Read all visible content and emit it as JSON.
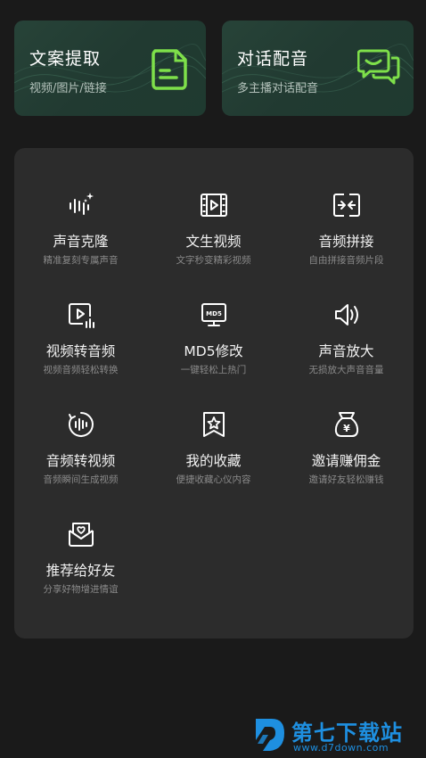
{
  "top_cards": [
    {
      "title": "文案提取",
      "subtitle": "视频/图片/链接",
      "icon": "document-extract-icon"
    },
    {
      "title": "对话配音",
      "subtitle": "多主播对话配音",
      "icon": "chat-dubbing-icon"
    }
  ],
  "features": [
    {
      "name": "声音克隆",
      "desc": "精准复刻专属声音",
      "icon": "voice-clone-icon"
    },
    {
      "name": "文生视频",
      "desc": "文字秒变精彩视频",
      "icon": "film-strip-icon"
    },
    {
      "name": "音频拼接",
      "desc": "自由拼接音频片段",
      "icon": "merge-arrows-icon"
    },
    {
      "name": "视频转音频",
      "desc": "视频音频轻松转换",
      "icon": "video-to-audio-icon"
    },
    {
      "name": "MD5修改",
      "desc": "一键轻松上热门",
      "icon": "md5-monitor-icon",
      "icon_text": "MD5"
    },
    {
      "name": "声音放大",
      "desc": "无损放大声音音量",
      "icon": "speaker-icon"
    },
    {
      "name": "音频转视频",
      "desc": "音频瞬间生成视频",
      "icon": "audio-to-video-icon"
    },
    {
      "name": "我的收藏",
      "desc": "便捷收藏心仪内容",
      "icon": "star-bookmark-icon"
    },
    {
      "name": "邀请赚佣金",
      "desc": "邀请好友轻松赚钱",
      "icon": "money-bag-icon",
      "icon_text": "¥"
    },
    {
      "name": "推荐给好友",
      "desc": "分享好物增进情谊",
      "icon": "heart-mail-icon"
    }
  ],
  "watermark": {
    "title": "第七下载站",
    "url": "www.d7down.com"
  },
  "colors": {
    "accent": "#7ee04a",
    "background": "#1a1a1a",
    "panel": "#2c2c2c",
    "watermark": "#1e8fe0"
  }
}
